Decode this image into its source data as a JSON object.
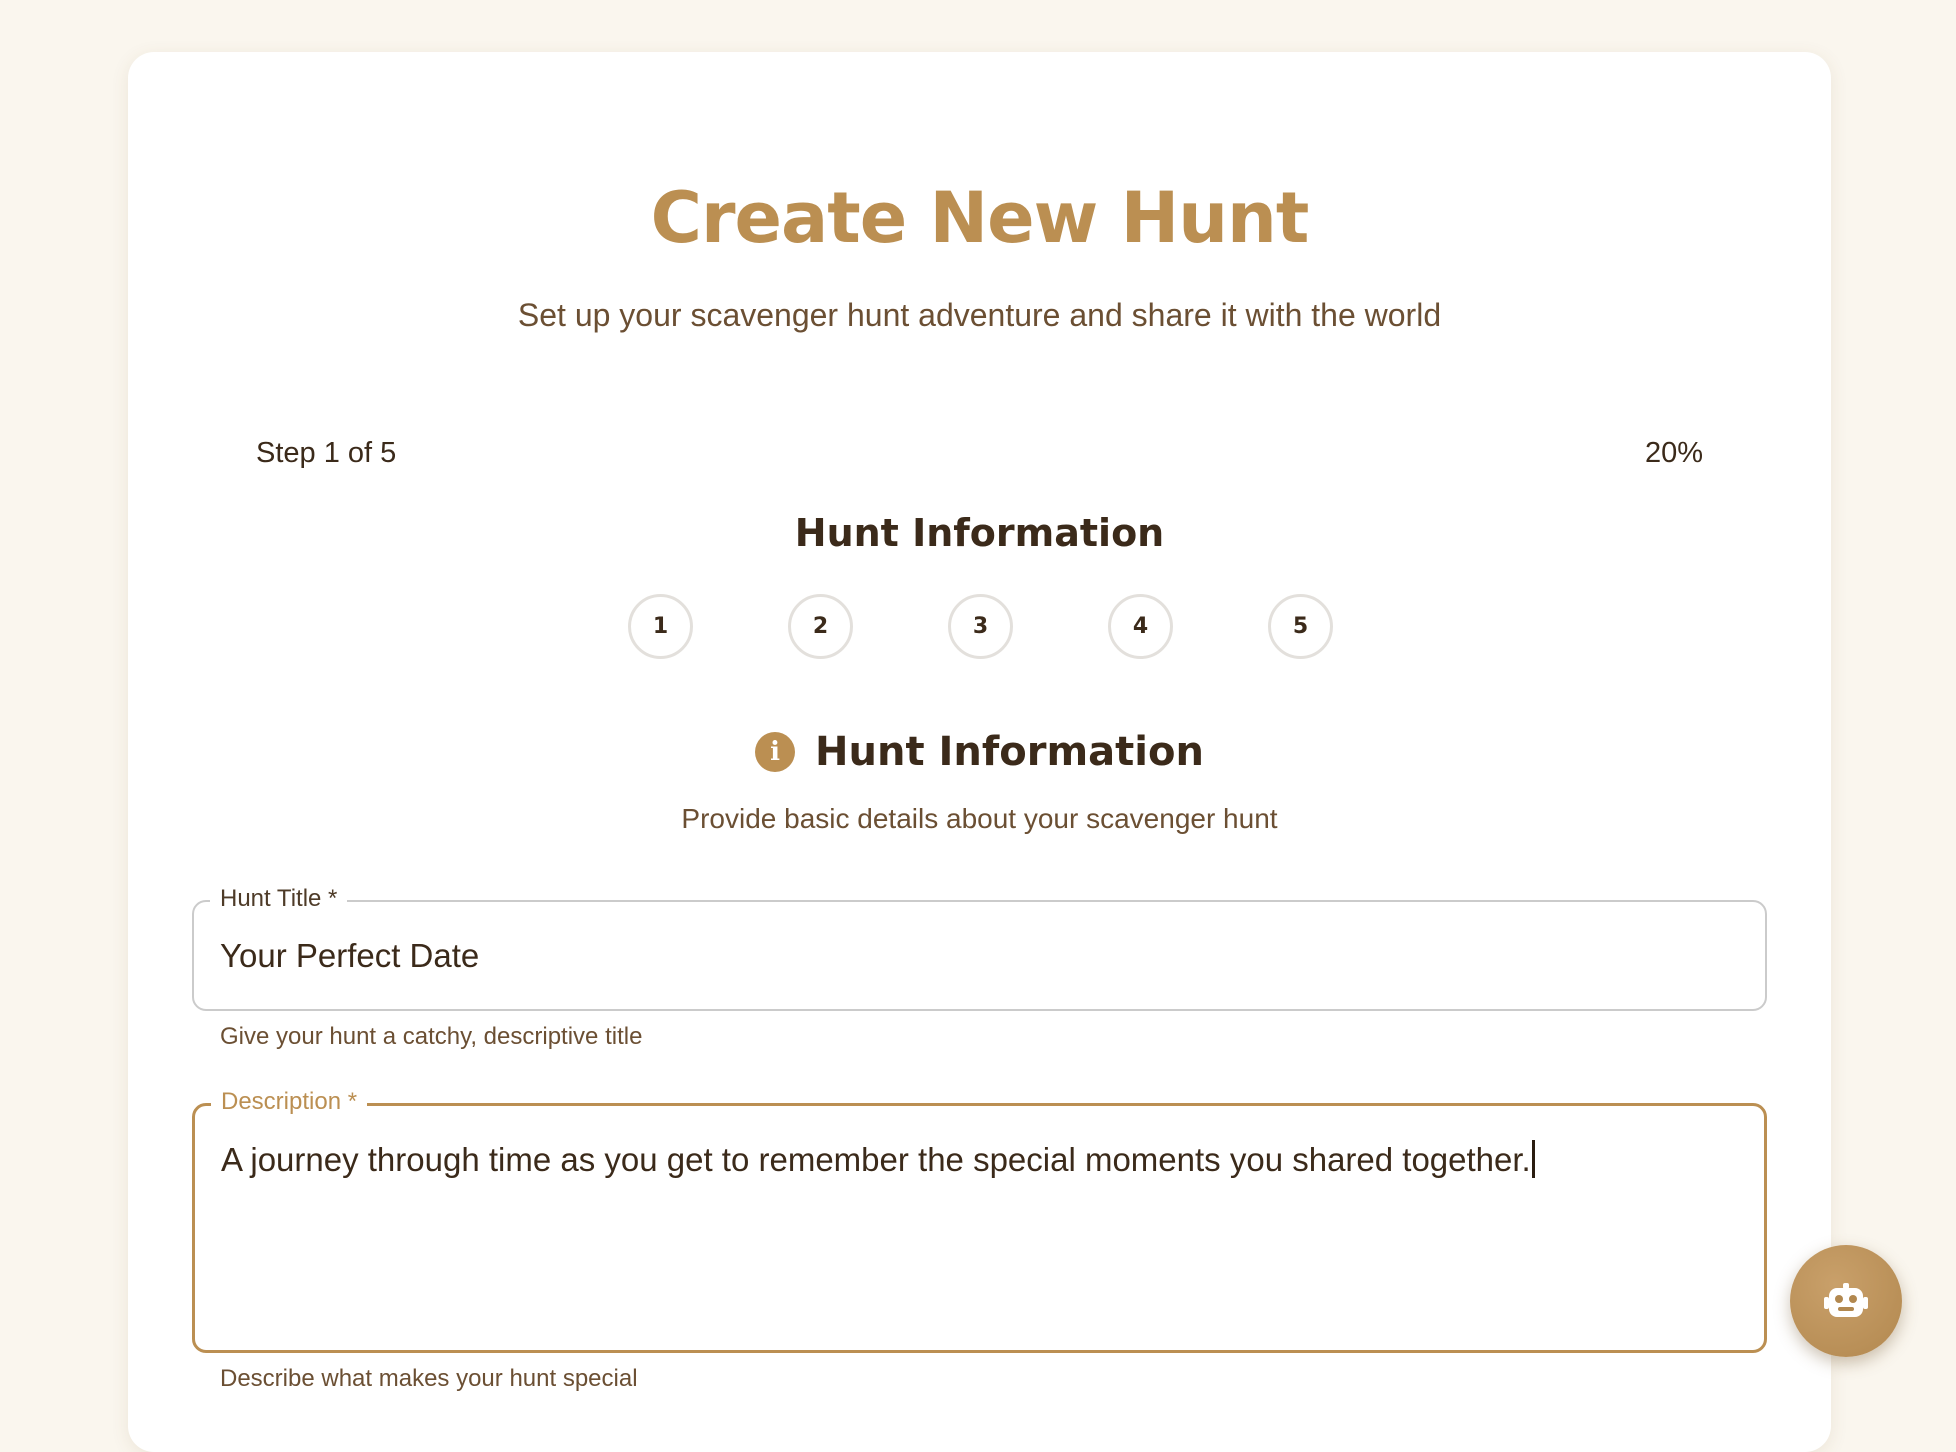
{
  "header": {
    "title": "Create New Hunt",
    "subtitle": "Set up your scavenger hunt adventure and share it with the world"
  },
  "progress": {
    "step_text": "Step 1 of 5",
    "percent_text": "20%",
    "percent_value": 20,
    "current_step_title": "Hunt Information",
    "steps": [
      "1",
      "2",
      "3",
      "4",
      "5"
    ]
  },
  "section": {
    "icon": "info-icon",
    "title": "Hunt Information",
    "subtitle": "Provide basic details about your scavenger hunt"
  },
  "form": {
    "title_field": {
      "label": "Hunt Title *",
      "value": "Your Perfect Date",
      "helper": "Give your hunt a catchy, descriptive title"
    },
    "description_field": {
      "label": "Description *",
      "value": "A journey through time as you get to remember the special moments you shared together.",
      "helper": "Describe what makes your hunt special"
    }
  },
  "assistant_button": {
    "icon": "robot-icon"
  },
  "colors": {
    "accent": "#bb8f52",
    "background": "#faf6ee",
    "text": "#3b2a1a",
    "muted_text": "#6b4f33"
  }
}
